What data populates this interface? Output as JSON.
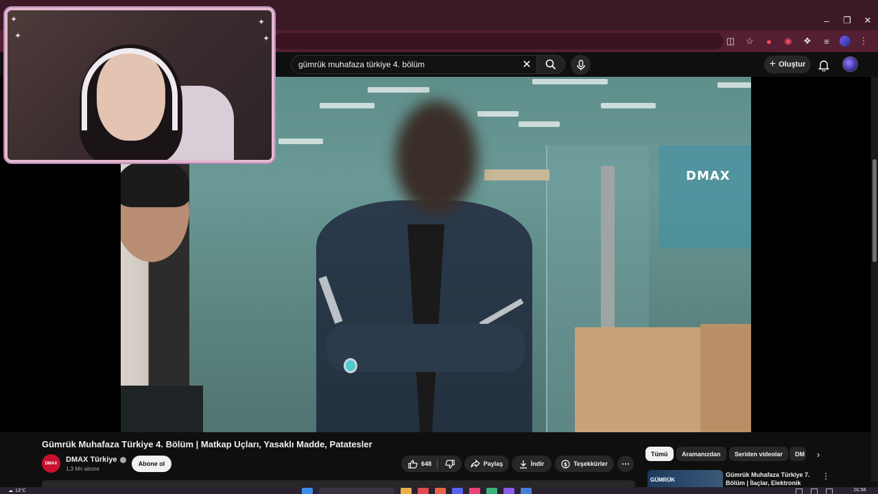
{
  "search": {
    "query": "gümrük muhafaza türkiye 4. bölüm"
  },
  "header": {
    "create_label": "Oluştur"
  },
  "player": {
    "channel_watermark": "DMAX"
  },
  "video": {
    "title": "Gümrük Muhafaza Türkiye 4. Bölüm | Matkap Uçları, Yasaklı Madde, Patatesler",
    "channel_name": "DMAX Türkiye",
    "channel_logo_text": "DMAX",
    "subscribers": "1,3 Mn abone",
    "subscribe_label": "Abone ol",
    "likes": "648",
    "share_label": "Paylaş",
    "download_label": "İndir",
    "thanks_label": "Teşekkürler"
  },
  "chips": [
    {
      "label": "Tümü",
      "active": true
    },
    {
      "label": "Aramanızdan",
      "active": false
    },
    {
      "label": "Seriden videolar",
      "active": false
    },
    {
      "label": "DM",
      "active": false
    }
  ],
  "recommendation": {
    "thumb_text": "GÜMRÜK",
    "title": "Gümrük Muhafaza Türkiye 7. Bölüm | İlaçlar, Elektronik"
  },
  "taskbar": {
    "temperature": "13°C",
    "time": "01:56"
  },
  "colors": {
    "tab_bar": "#3b1a25",
    "address_bar": "#541f32",
    "yt_background": "#0f0f0f",
    "webcam_border": "#e3b8cf"
  },
  "icons": [
    "minimize-icon",
    "maximize-icon",
    "close-icon",
    "search-icon",
    "mic-icon",
    "plus-icon",
    "bell-icon",
    "like-icon",
    "dislike-icon",
    "share-icon",
    "download-icon",
    "thanks-icon",
    "more-icon",
    "chevron-right-icon",
    "windows-icon"
  ]
}
